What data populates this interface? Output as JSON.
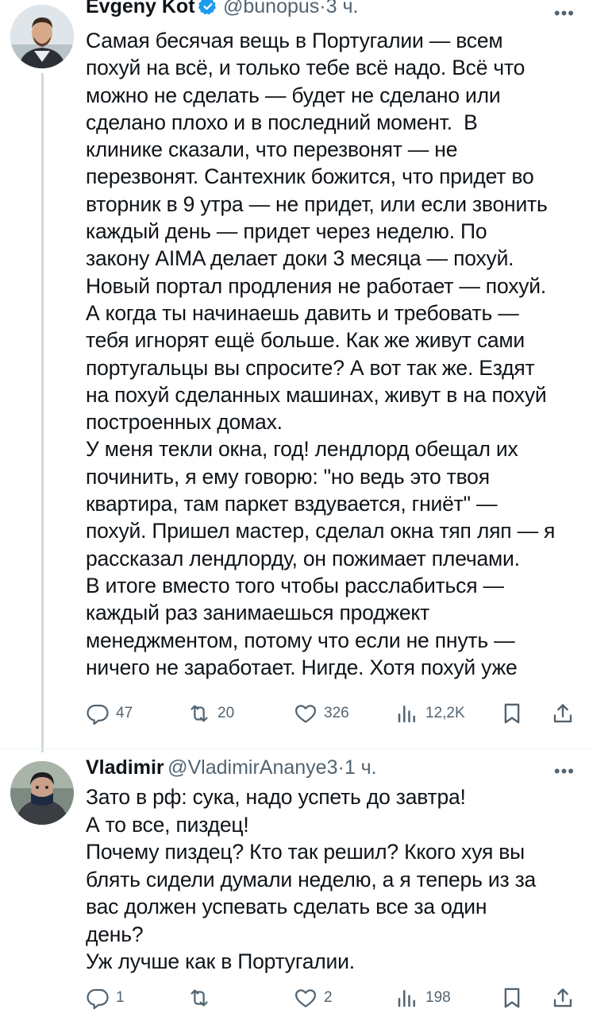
{
  "tweets": [
    {
      "author": "Evgeny Kot",
      "handle": "@bunopus",
      "separator": "·",
      "time": "3 ч.",
      "text": "Самая бесячая вещь в Португалии — всем\nпохуй на всё, и только тебе всё надо. Всё что\nможно не сделать — будет не сделано или\nсделано плохо и в последний момент.  В\nклинике сказали, что перезвонят — не\nперезвонят. Сантехник божится, что придет во\nвторник в 9 утра — не придет, или если звонить\nкаждый день — придет через неделю. По\nзакону AIMA делает доки 3 месяца — похуй.\nНовый портал продления не работает — похуй.\nА когда ты начинаешь давить и требовать —\nтебя игнорят ещё больше. Как же живут сами\nпортугальцы вы спросите? А вот так же. Ездят\nна похуй сделанных машинах, живут в на похуй\nпостроенных домах.\nУ меня текли окна, год! лендлорд обещал их\nпочинить, я ему говорю: \"но ведь это твоя\nквартира, там паркет вздувается, гниёт\" —\nпохуй. Пришел мастер, сделал окна тяп ляп — я\nрассказал лендлорду, он пожимает плечами.\nВ итоге вместо того чтобы расслабиться —\nкаждый раз занимаешься проджект\nменеджментом, потому что если не пнуть —\nничего не заработает. Нигде. Хотя похуй уже",
      "replies": "47",
      "retweets": "20",
      "likes": "326",
      "views": "12,2K",
      "more": "•••"
    },
    {
      "author": "Vladimir",
      "handle": "@VladimirAnanye3",
      "separator": "·",
      "time": "1 ч.",
      "text": "Зато в рф: сука, надо успеть до завтра!\nА то все, пиздец!\nПочему пиздец? Кто так решил? Ккого хуя вы\nблять сидели думали неделю, а я теперь из за\nвас должен успевать сделать все за один\nдень?\nУж лучше как в Португалии.",
      "replies": "1",
      "retweets": "",
      "likes": "2",
      "views": "198",
      "more": "•••"
    }
  ],
  "icons": {
    "reply": "reply-icon",
    "retweet": "retweet-icon",
    "like": "heart-icon",
    "views": "views-icon",
    "bookmark": "bookmark-icon",
    "share": "share-icon",
    "verified": "verified-badge-icon"
  },
  "colors": {
    "text": "#0f1419",
    "secondary": "#536471",
    "verified": "#1d9bf0",
    "thread_line": "#cfd9de"
  }
}
